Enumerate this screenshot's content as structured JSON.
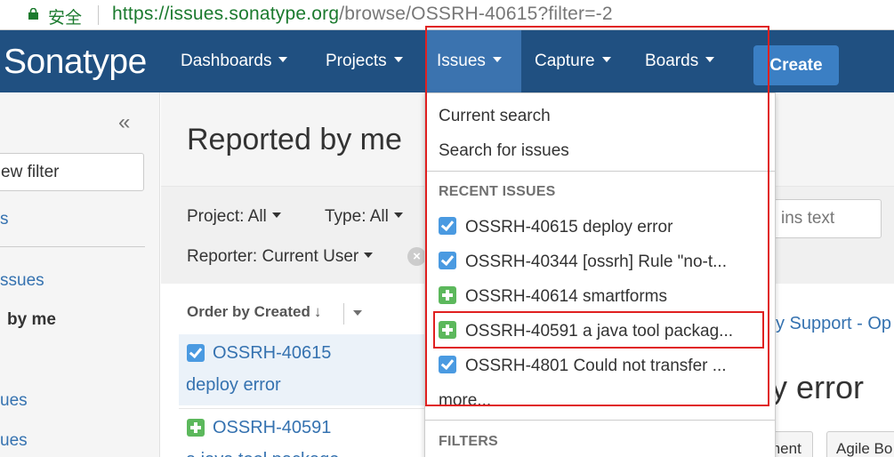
{
  "address_bar": {
    "secure_label": "安全",
    "url_scheme": "https://",
    "url_host": "issues.sonatype.org",
    "url_path": "/browse/OSSRH-40615?filter=-2"
  },
  "nav": {
    "logo": "Sonatype",
    "items": [
      {
        "label": "Dashboards"
      },
      {
        "label": "Projects"
      },
      {
        "label": "Issues"
      },
      {
        "label": "Capture"
      },
      {
        "label": "Boards"
      }
    ],
    "create_label": "Create"
  },
  "sidebar": {
    "collapse_glyph": "«",
    "new_filter_fragment": "ew filter",
    "link_fragment_1": "s",
    "link_fragment_2": "ssues",
    "bold_fragment": "by me",
    "link_fragment_3": "ues",
    "link_fragment_4": "ues"
  },
  "main": {
    "page_title": "Reported by me",
    "filters": {
      "project": "Project: All",
      "type": "Type: All",
      "reporter": "Reporter: Current User",
      "text_placeholder_fragment": "ins text"
    },
    "order_by": "Order by Created",
    "order_arrow": "↓",
    "issues": [
      {
        "key": "OSSRH-40615",
        "summary": "deploy error",
        "type": "task"
      },
      {
        "key": "OSSRH-40591",
        "summary": "a java tool package",
        "type": "new-feature"
      }
    ],
    "detail": {
      "crumb_fragment": "y Support - Op",
      "title_fragment": "y error",
      "buttons": [
        "ment",
        "Agile Bo"
      ]
    }
  },
  "dropdown": {
    "current_search": "Current search",
    "search_for_issues": "Search for issues",
    "recent_heading": "RECENT ISSUES",
    "recent": [
      {
        "text": "OSSRH-40615 deploy error",
        "type": "task"
      },
      {
        "text": "OSSRH-40344 [ossrh] Rule \"no-t...",
        "type": "task"
      },
      {
        "text": "OSSRH-40614 smartforms",
        "type": "new-feature"
      },
      {
        "text": "OSSRH-40591 a java tool packag...",
        "type": "new-feature"
      },
      {
        "text": "OSSRH-4801 Could not transfer ...",
        "type": "task"
      }
    ],
    "more": "more...",
    "filters_heading": "FILTERS"
  },
  "colors": {
    "nav_bg": "#205081",
    "nav_active": "#3b73af",
    "create_button": "#3b7fc4",
    "link": "#3572b0",
    "annotation_red": "#e02020",
    "task_icon": "#4a9ae1",
    "new_feature_icon": "#5cb85c"
  },
  "icons": [
    "lock-icon",
    "collapse-sidebar-icon",
    "task-icon",
    "new-feature-icon",
    "clear-filter-icon",
    "sort-down-icon"
  ]
}
